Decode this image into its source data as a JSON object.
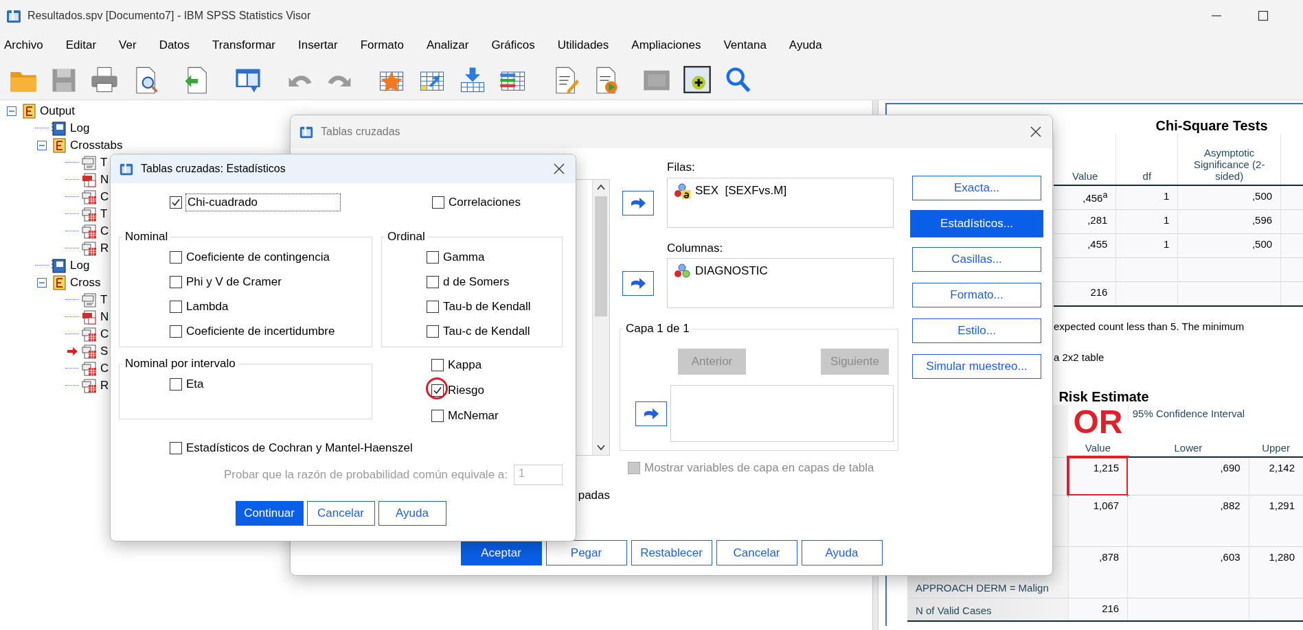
{
  "window": {
    "title": "Resultados.spv [Documento7] - IBM SPSS Statistics Visor"
  },
  "menu": [
    {
      "label": "Archivo"
    },
    {
      "label": "Editar"
    },
    {
      "label": "Ver"
    },
    {
      "label": "Datos"
    },
    {
      "label": "Transformar"
    },
    {
      "label": "Insertar"
    },
    {
      "label": "Formato"
    },
    {
      "label": "Analizar"
    },
    {
      "label": "Gráficos"
    },
    {
      "label": "Utilidades"
    },
    {
      "label": "Ampliaciones"
    },
    {
      "label": "Ventana"
    },
    {
      "label": "Ayuda"
    }
  ],
  "toolbar": [
    {
      "kind": "folder",
      "disabled": false
    },
    {
      "kind": "save",
      "disabled": true
    },
    {
      "kind": "print",
      "disabled": false
    },
    {
      "kind": "preview",
      "disabled": false
    },
    {
      "kind": "export",
      "disabled": false
    },
    {
      "kind": "window",
      "disabled": false
    },
    {
      "kind": "undo",
      "disabled": true
    },
    {
      "kind": "redo",
      "disabled": true
    },
    {
      "kind": "star_table",
      "disabled": false
    },
    {
      "kind": "table_arrow",
      "disabled": false
    },
    {
      "kind": "insert_rows",
      "disabled": false
    },
    {
      "kind": "variables",
      "disabled": false
    },
    {
      "kind": "edit_doc",
      "disabled": false
    },
    {
      "kind": "run_doc",
      "disabled": false
    },
    {
      "kind": "image",
      "disabled": true
    },
    {
      "kind": "add",
      "disabled": false
    },
    {
      "kind": "search",
      "disabled": false
    }
  ],
  "outline": {
    "label": "Output",
    "kind": "book",
    "expanded": true,
    "children": [
      {
        "label": "Log",
        "kind": "log",
        "current": false
      },
      {
        "label": "Crosstabs",
        "kind": "book",
        "expanded": true,
        "children": [
          {
            "label": "T",
            "kind": "title",
            "current": false
          },
          {
            "label": "N",
            "kind": "notes",
            "current": false
          },
          {
            "label": "C",
            "kind": "table",
            "current": false
          },
          {
            "label": "T",
            "kind": "table",
            "current": false
          },
          {
            "label": "C",
            "kind": "table",
            "current": false
          },
          {
            "label": "R",
            "kind": "table",
            "current": false
          }
        ]
      },
      {
        "label": "Log",
        "kind": "log",
        "current": false
      },
      {
        "label": "Cross",
        "kind": "book",
        "expanded": true,
        "children": [
          {
            "label": "T",
            "kind": "title",
            "current": false
          },
          {
            "label": "N",
            "kind": "notes",
            "current": false
          },
          {
            "label": "C",
            "kind": "table",
            "current": false
          },
          {
            "label": "S",
            "kind": "table",
            "current": true
          },
          {
            "label": "C",
            "kind": "table",
            "current": false
          },
          {
            "label": "R",
            "kind": "table",
            "current": false
          }
        ]
      }
    ]
  },
  "viewer": {
    "chi_square_tests": {
      "title": "Chi-Square Tests",
      "columns": [
        "Value",
        "df",
        "Asymptotic Significance (2-sided)"
      ],
      "rows": [
        {
          "cells": [
            ",456$^{a}$",
            "1",
            ",500"
          ]
        },
        {
          "cells": [
            ",281",
            "1",
            ",596"
          ]
        },
        {
          "cells": [
            ",455",
            "1",
            ",500"
          ]
        },
        {
          "cells": [
            "",
            "",
            ""
          ]
        },
        {
          "cells": [
            "216",
            "",
            ""
          ]
        }
      ],
      "footnotes": [
        "expected count less than 5. The minimum",
        "a 2x2 table"
      ]
    },
    "risk_estimate": {
      "title": "Risk Estimate",
      "annotation": "OR",
      "group_header": "95% Confidence Interval",
      "columns": [
        "Value",
        "Lower",
        "Upper"
      ],
      "rows": [
        {
          "cells": [
            "1,215",
            ",690",
            "2,142"
          ],
          "value_marked": true
        },
        {
          "cells": [
            "1,067",
            ",882",
            "1,291"
          ],
          "value_marked": false
        },
        {
          "label": "APPROACH DERM = Malign",
          "cells": [
            ",878",
            ",603",
            "1,280"
          ],
          "value_marked": false
        },
        {
          "label": "N of Valid Cases",
          "cells": [
            "216",
            "",
            ""
          ],
          "value_marked": false
        }
      ]
    }
  },
  "crosstabs_dialog": {
    "title": "Tablas cruzadas",
    "list_fragment": "padas",
    "rows_label": "Filas:",
    "rows": [
      {
        "name": "SEX  [SEXFvs.M]",
        "kind": "string"
      }
    ],
    "columns_label": "Columnas:",
    "columns": [
      {
        "name": "DIAGNOSTIC",
        "kind": "numeric"
      }
    ],
    "layer": {
      "title": "Capa 1 de 1",
      "previous": {
        "label": "Anterior",
        "disabled": true
      },
      "next": {
        "label": "Siguiente",
        "disabled": true
      }
    },
    "show_layer_variables": {
      "label": "Mostrar variables de capa en capas de tabla",
      "checked": false,
      "disabled": true
    },
    "side_buttons": [
      {
        "label": "Exacta...",
        "selected": false
      },
      {
        "label": "Estadísticos...",
        "selected": true
      },
      {
        "label": "Casillas...",
        "selected": false
      },
      {
        "label": "Formato...",
        "selected": false
      },
      {
        "label": "Estilo...",
        "selected": false
      },
      {
        "label": "Simular muestreo...",
        "selected": false
      }
    ],
    "buttons": [
      {
        "label": "Aceptar",
        "default": true
      },
      {
        "label": "Pegar",
        "default": false
      },
      {
        "label": "Restablecer",
        "default": false
      },
      {
        "label": "Cancelar",
        "default": false
      },
      {
        "label": "Ayuda",
        "default": false
      }
    ]
  },
  "statistics_dialog": {
    "title": "Tablas cruzadas: Estadísticos",
    "chi_square": {
      "label": "Chi-cuadrado",
      "checked": true,
      "focused": true
    },
    "correlations": {
      "label": "Correlaciones",
      "checked": false,
      "focused": false
    },
    "groups": [
      {
        "title": "Nominal",
        "items": [
          {
            "label": "Coeficiente de contingencia",
            "checked": false
          },
          {
            "label": "Phi y V de Cramer",
            "checked": false
          },
          {
            "label": "Lambda",
            "checked": false
          },
          {
            "label": "Coeficiente de incertidumbre",
            "checked": false
          }
        ]
      },
      {
        "title": "Ordinal",
        "items": [
          {
            "label": "Gamma",
            "checked": false
          },
          {
            "label": "d de Somers",
            "checked": false
          },
          {
            "label": "Tau-b de Kendall",
            "checked": false
          },
          {
            "label": "Tau-c de Kendall",
            "checked": false
          }
        ]
      },
      {
        "title": "Nominal por intervalo",
        "items": [
          {
            "label": "Eta",
            "checked": false
          }
        ]
      }
    ],
    "extra": [
      {
        "label": "Kappa",
        "checked": false,
        "circled": false
      },
      {
        "label": "Riesgo",
        "checked": true,
        "circled": true
      },
      {
        "label": "McNemar",
        "checked": false,
        "circled": false
      }
    ],
    "cochran": {
      "label": "Estadísticos de Cochran y Mantel-Haenszel",
      "checked": false
    },
    "common_odds": {
      "label": "Probar que la razón de probabilidad común equivale a:",
      "value": "1",
      "disabled": true
    },
    "buttons": [
      {
        "label": "Continuar",
        "default": true
      },
      {
        "label": "Cancelar",
        "default": false
      },
      {
        "label": "Ayuda",
        "default": false
      }
    ]
  }
}
